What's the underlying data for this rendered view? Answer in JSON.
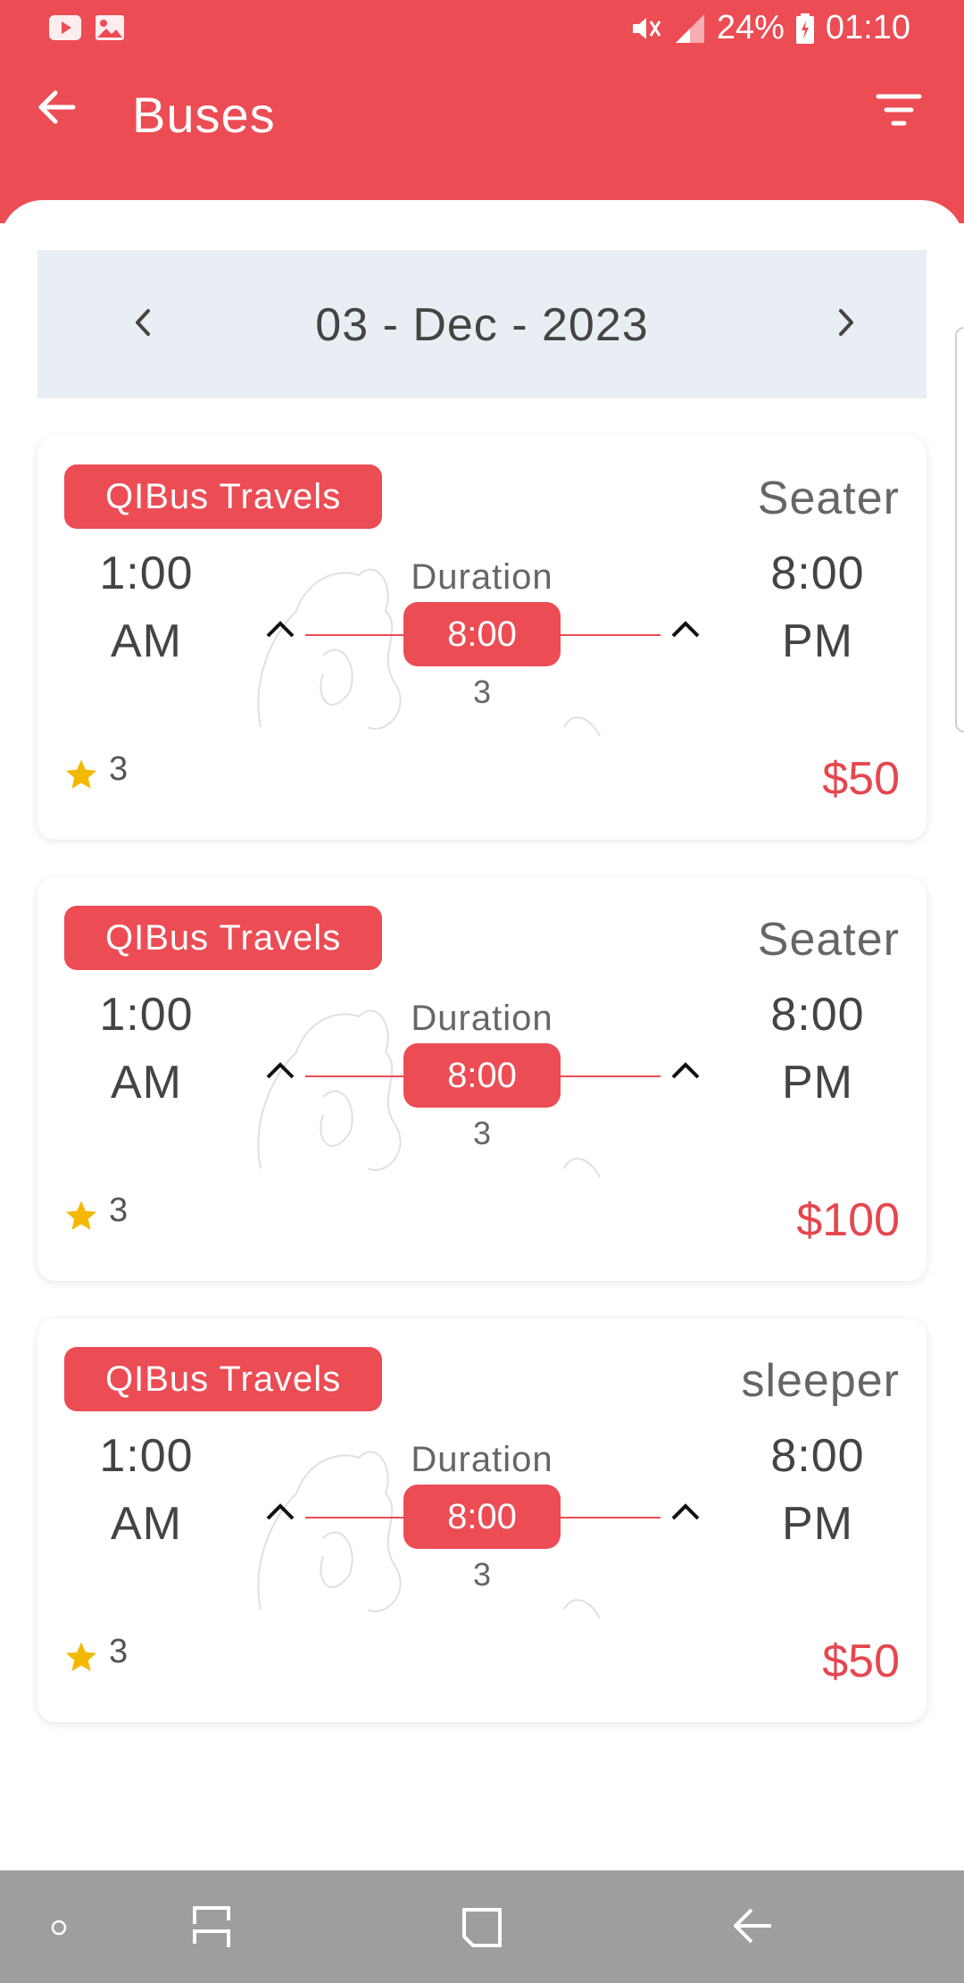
{
  "status_bar": {
    "battery": "24%",
    "time": "01:10"
  },
  "toolbar": {
    "title": "Buses"
  },
  "date_selector": {
    "date": "03 - Dec - 2023"
  },
  "buses": [
    {
      "operator": "QIBus Travels",
      "type": "Seater",
      "departure_time": "1:00",
      "departure_period": "AM",
      "duration_label": "Duration",
      "duration": "8:00",
      "stops": "3",
      "arrival_time": "8:00",
      "arrival_period": "PM",
      "rating": "3",
      "price": "$50"
    },
    {
      "operator": "QIBus Travels",
      "type": "Seater",
      "departure_time": "1:00",
      "departure_period": "AM",
      "duration_label": "Duration",
      "duration": "8:00",
      "stops": "3",
      "arrival_time": "8:00",
      "arrival_period": "PM",
      "rating": "3",
      "price": "$100"
    },
    {
      "operator": "QIBus Travels",
      "type": "sleeper",
      "departure_time": "1:00",
      "departure_period": "AM",
      "duration_label": "Duration",
      "duration": "8:00",
      "stops": "3",
      "arrival_time": "8:00",
      "arrival_period": "PM",
      "rating": "3",
      "price": "$50"
    }
  ],
  "icons": {
    "back": "arrow-left-icon",
    "filter": "filter-icon",
    "prev": "chevron-left-icon",
    "next": "chevron-right-icon",
    "star": "star-icon"
  },
  "colors": {
    "brand": "#ec4c54",
    "price": "#e5474f",
    "star": "#f5b800",
    "date_bar": "#e8eef4"
  }
}
